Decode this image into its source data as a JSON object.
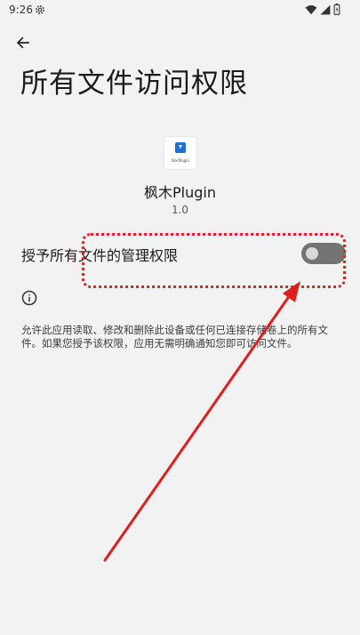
{
  "status_bar": {
    "time": "9:26"
  },
  "header": {
    "title": "所有文件访问权限"
  },
  "app": {
    "icon_label": "DocPlugin",
    "name": "枫木Plugin",
    "version": "1.0"
  },
  "permission": {
    "label": "授予所有文件的管理权限",
    "enabled": false
  },
  "description": {
    "text": "允许此应用读取、修改和删除此设备或任何已连接存储卷上的所有文件。如果您授予该权限，应用无需明确通知您即可访问文件。"
  },
  "colors": {
    "background": "#f2f2f2",
    "toggle_off": "#737373",
    "annotation_red": "#e02424"
  }
}
